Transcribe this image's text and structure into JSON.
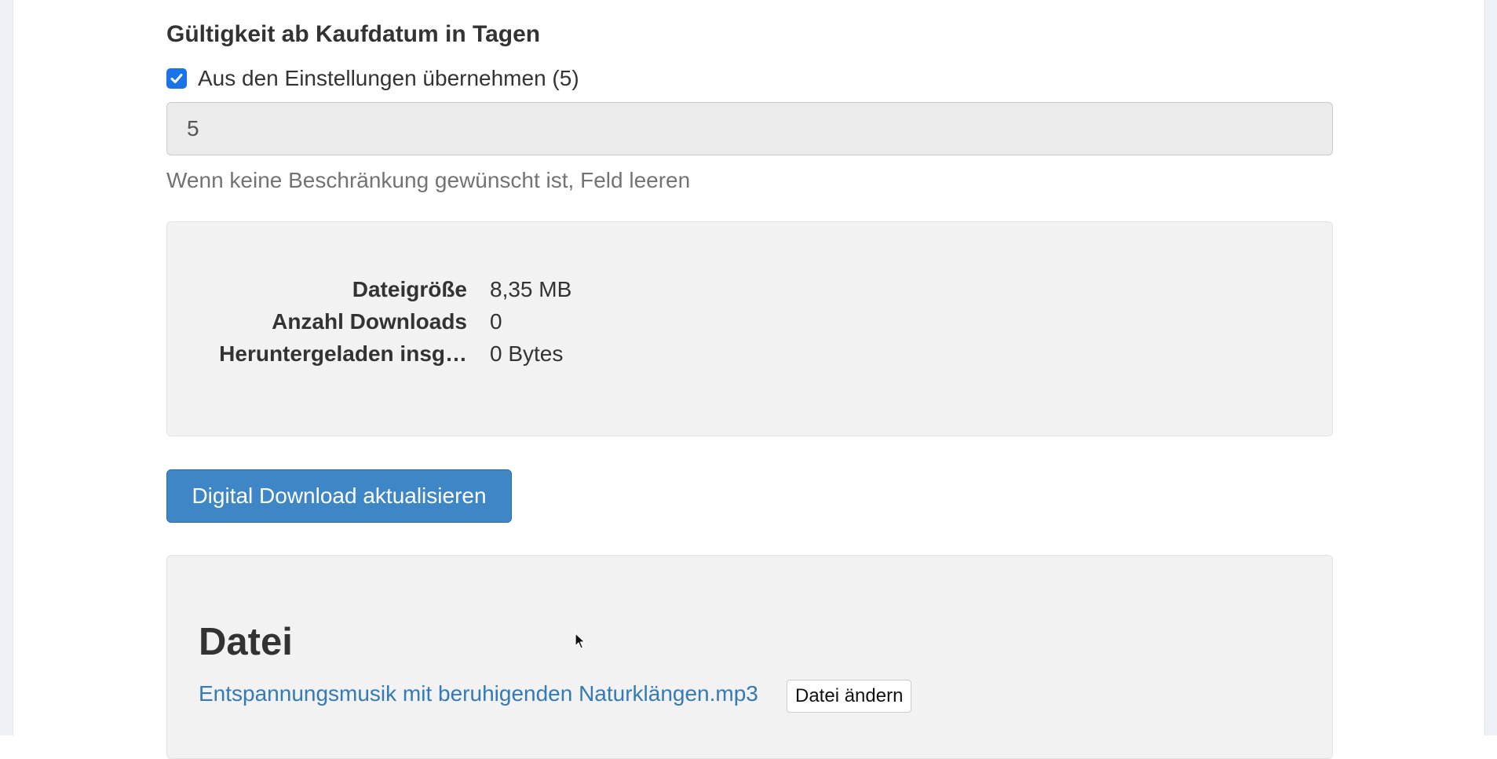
{
  "validity": {
    "heading": "Gültigkeit ab Kaufdatum in Tagen",
    "checkbox_label": "Aus den Einstellungen übernehmen (5)",
    "checkbox_checked": true,
    "days_value": "5",
    "help_text": "Wenn keine Beschränkung gewünscht ist, Feld leeren"
  },
  "stats": [
    {
      "label": "Dateigröße",
      "value": "8,35 MB"
    },
    {
      "label": "Anzahl Downloads",
      "value": "0"
    },
    {
      "label": "Heruntergeladen insg…",
      "value": "0 Bytes"
    }
  ],
  "actions": {
    "update_label": "Digital Download aktualisieren"
  },
  "file": {
    "heading": "Datei",
    "filename": "Entspannungsmusik mit beruhigenden Naturklängen.mp3",
    "change_label": "Datei ändern"
  },
  "colors": {
    "primary": "#3f86c6",
    "link": "#337ab7",
    "checkbox": "#1a73e8",
    "well": "#f2f2f2"
  },
  "icons": {
    "checkbox": "checkmark-icon",
    "cursor": "mouse-pointer-icon"
  }
}
